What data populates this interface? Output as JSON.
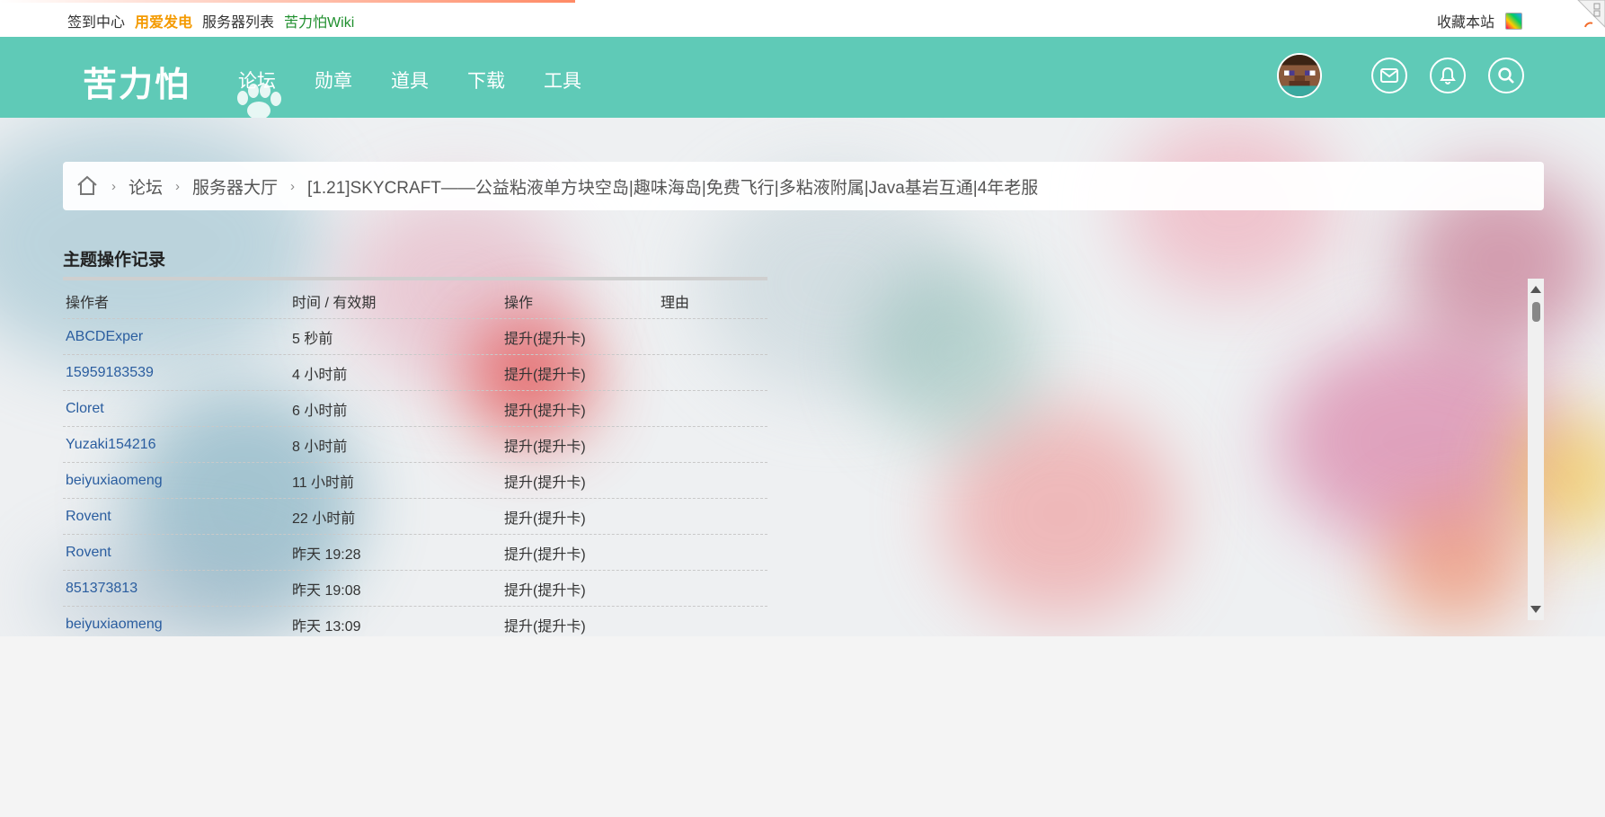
{
  "topbar": {
    "links": [
      {
        "label": "签到中心",
        "style": "normal"
      },
      {
        "label": "用爱发电",
        "style": "orange"
      },
      {
        "label": "服务器列表",
        "style": "normal"
      },
      {
        "label": "苦力怕Wiki",
        "style": "green"
      }
    ],
    "bookmark_label": "收藏本站"
  },
  "header": {
    "logo": "苦力怕",
    "nav": [
      "论坛",
      "勋章",
      "道具",
      "下载",
      "工具"
    ],
    "accent_color": "#5fcab7"
  },
  "breadcrumb": {
    "items": [
      "论坛",
      "服务器大厅",
      "[1.21]SKYCRAFT——公益粘液单方块空岛|趣味海岛|免费飞行|多粘液附属|Java基岩互通|4年老服"
    ]
  },
  "log": {
    "title": "主题操作记录",
    "columns": [
      "操作者",
      "时间 / 有效期",
      "操作",
      "理由"
    ],
    "rows": [
      {
        "user": "ABCDExper",
        "time": "5 秒前",
        "action": "提升(提升卡)",
        "reason": ""
      },
      {
        "user": "15959183539",
        "time": "4 小时前",
        "action": "提升(提升卡)",
        "reason": ""
      },
      {
        "user": "Cloret",
        "time": "6 小时前",
        "action": "提升(提升卡)",
        "reason": ""
      },
      {
        "user": "Yuzaki154216",
        "time": "8 小时前",
        "action": "提升(提升卡)",
        "reason": ""
      },
      {
        "user": "beiyuxiaomeng",
        "time": "11 小时前",
        "action": "提升(提升卡)",
        "reason": ""
      },
      {
        "user": "Rovent",
        "time": "22 小时前",
        "action": "提升(提升卡)",
        "reason": ""
      },
      {
        "user": "Rovent",
        "time": "昨天 19:28",
        "action": "提升(提升卡)",
        "reason": ""
      },
      {
        "user": "851373813",
        "time": "昨天 19:08",
        "action": "提升(提升卡)",
        "reason": ""
      },
      {
        "user": "beiyuxiaomeng",
        "time": "昨天 13:09",
        "action": "提升(提升卡)",
        "reason": ""
      }
    ]
  }
}
